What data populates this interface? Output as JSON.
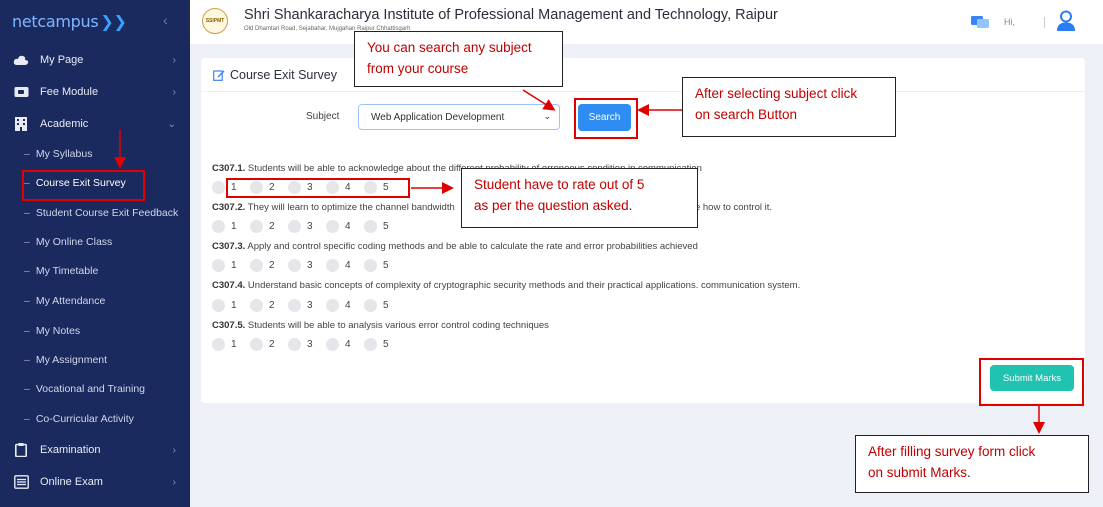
{
  "sidebar": {
    "brand": "netcampus",
    "items": [
      {
        "label": "My Page",
        "icon": "cloud-icon"
      },
      {
        "label": "Fee Module",
        "icon": "wallet-icon"
      },
      {
        "label": "Academic",
        "icon": "building-icon"
      },
      {
        "label": "Examination",
        "icon": "clipboard-icon"
      },
      {
        "label": "Online Exam",
        "icon": "list-icon"
      }
    ],
    "sub_items": [
      "My Syllabus",
      "Course Exit Survey",
      "Student Course Exit Feedback",
      "My Online Class",
      "My Timetable",
      "My Attendance",
      "My Notes",
      "My Assignment",
      "Vocational and Training",
      "Co-Curricular Activity"
    ]
  },
  "header": {
    "institute_name": "Shri Shankaracharya Institute of Professional Management and Technology, Raipur",
    "institute_address": "Old Dhamtari Road, Sejabahar, Mujgahan Raipur Chhattisgarh",
    "logo_text": "SSIPMT",
    "greeting": "Hi,"
  },
  "survey": {
    "title": "Course Exit Survey",
    "subject_label": "Subject",
    "subject_value": "Web Application Development",
    "search_label": "Search",
    "submit_label": "Submit Marks",
    "rating_options": [
      "1",
      "2",
      "3",
      "4",
      "5"
    ],
    "questions": [
      {
        "code": "C307.1.",
        "text": " Students will be able to acknowledge about the different probability of erroneous condition in communication"
      },
      {
        "code": "C307.2.",
        "text": " They will learn to optimize the channel bandwidth                                                                                    of the how to control it."
      },
      {
        "code": "C307.3.",
        "text": " Apply and control specific coding methods and be able to calculate the rate and error probabilities achieved"
      },
      {
        "code": "C307.4.",
        "text": " Understand basic concepts of complexity of cryptographic security methods and their practical applications. communication system."
      },
      {
        "code": "C307.5.",
        "text": " Students will be able to analysis various error control coding techniques"
      }
    ]
  },
  "annotations": {
    "search_any": [
      "You can search any subject",
      "from your course"
    ],
    "after_select": [
      "After selecting subject click",
      "on search Button"
    ],
    "rate": [
      "Student have to rate out of 5",
      "as per the question asked"
    ],
    "after_fill": [
      "After filling survey form click",
      "on submit Marks"
    ]
  },
  "colors": {
    "sidebar_bg": "#1b2a5e",
    "search_button": "#2e8cf2",
    "submit_button": "#1fc3b0",
    "annotation_red": "#e00000"
  }
}
